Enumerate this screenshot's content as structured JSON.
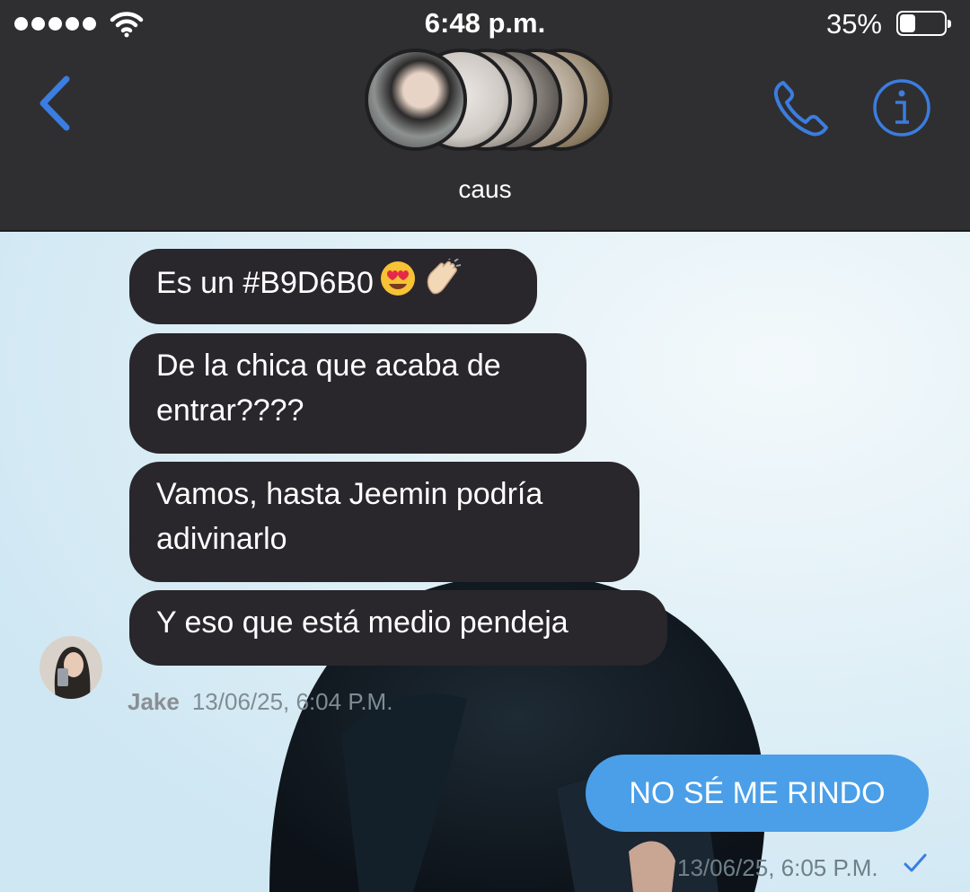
{
  "status_bar": {
    "time": "6:48 p.m.",
    "battery_percent_text": "35%",
    "battery_level": 0.35,
    "signal_icon": "signal-dots-icon",
    "wifi_icon": "wifi-icon"
  },
  "header": {
    "group_name": "caus",
    "back_icon": "chevron-left-icon",
    "call_icon": "phone-icon",
    "info_icon": "info-icon",
    "accent_color": "#3b7de0"
  },
  "messages": [
    {
      "text": "Es un #B9D6B0",
      "emoji": [
        "heart-eyes-emoji",
        "clapping-hands-emoji"
      ]
    },
    {
      "line1": "De la chica que acaba de",
      "line2": "entrar????"
    },
    {
      "line1": "Vamos, hasta Jeemin podría",
      "line2": "adivinarlo"
    },
    {
      "text": "Y eso que está medio pendeja"
    }
  ],
  "incoming_meta": {
    "sender": "Jake",
    "timestamp": "13/06/25, 6:04 P.M."
  },
  "outgoing": {
    "text": "NO SÉ ME RINDO",
    "timestamp": "13/06/25, 6:05 P.M.",
    "status_icon": "checkmark-icon"
  },
  "colors": {
    "incoming_bubble": "#29272c",
    "outgoing_bubble": "#4a9fe8",
    "header_bg": "#2f2f31"
  }
}
